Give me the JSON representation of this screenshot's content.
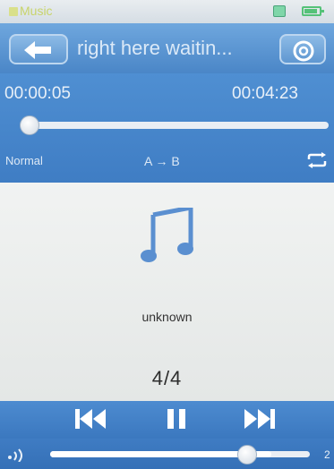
{
  "status_bar": {
    "app_title": "Music",
    "icons": [
      "notification-icon",
      "battery-icon"
    ]
  },
  "header": {
    "back_icon": "arrow-left-icon",
    "track_title": "right here waitin...",
    "settings_icon": "gear-icon"
  },
  "playback": {
    "elapsed": "00:00:05",
    "total": "00:04:23",
    "progress_fraction": 0.02,
    "eq_mode": "Normal",
    "ab_repeat": "A → B",
    "repeat_icon": "repeat-icon"
  },
  "now_playing": {
    "art_icon": "music-note-icon",
    "artist": "unknown",
    "track_position": "4/4"
  },
  "controls": {
    "prev_icon": "skip-previous-icon",
    "pause_icon": "pause-icon",
    "next_icon": "skip-next-icon"
  },
  "volume": {
    "icon": "volume-icon",
    "level_fraction": 0.85,
    "value": "2"
  },
  "colors": {
    "accent_blue": "#4a86c7",
    "content_bg": "#eef0ef",
    "icon_blue": "#5a8fd0",
    "text_light": "#e8f0f8"
  }
}
